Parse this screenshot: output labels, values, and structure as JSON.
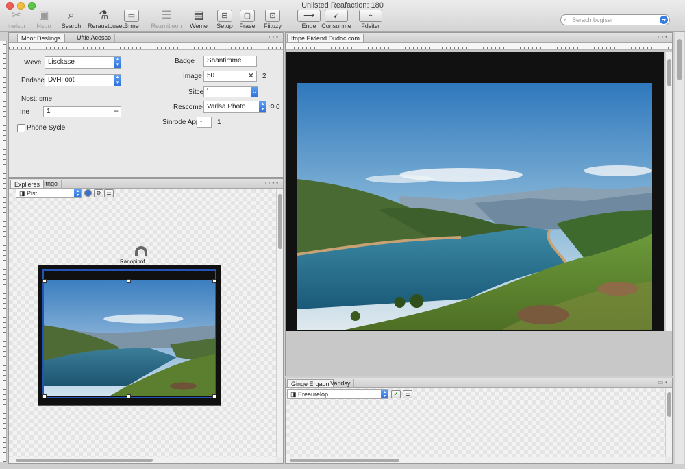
{
  "window": {
    "title": "Unlisted Reafaction: 180"
  },
  "toolbar": {
    "left_items": [
      {
        "label": "Inelsor",
        "glyph": "✂"
      },
      {
        "label": "Nsdo",
        "glyph": "▣"
      },
      {
        "label": "Search",
        "glyph": "⌕"
      },
      {
        "label": "Reraustcused",
        "glyph": "⚗"
      },
      {
        "label": "Brme",
        "glyph": "▭"
      },
      {
        "label": "Rezmitieon",
        "glyph": "☰"
      },
      {
        "label": "Weme",
        "glyph": "▤"
      },
      {
        "label": "Setup",
        "glyph": "⊟"
      },
      {
        "label": "Frase",
        "glyph": "▢"
      },
      {
        "label": "Fiituzy",
        "glyph": "⊡"
      }
    ],
    "right_items": [
      {
        "label": "Enge",
        "glyph": "⟶"
      },
      {
        "label": "Consunme",
        "glyph": "➹"
      },
      {
        "label": "Fdsiter",
        "glyph": "⌁"
      }
    ],
    "search_placeholder": "Serach bvgiser"
  },
  "properties": {
    "tabs": [
      "Moor Deslings",
      "Uftle Acesso"
    ],
    "weve_label": "Weve",
    "weve_value": "Lisckase",
    "produce_label": "Pndace",
    "produce_value": "DvHl oot",
    "nost_label": "Nost: sme",
    "ine_label": "Ine",
    "ine_value": "1",
    "phone_label": "Phone Sycle",
    "badge_label": "Badge",
    "badge_value": "Shantimme",
    "image_label": "Image",
    "image_value": "50",
    "image_count": "2",
    "sitce_label": "Sitce",
    "sitce_value": "'",
    "rescomee_label": "Rescomee",
    "rescomee_value": "Varlsa Photo",
    "rescomee_suffix": "0",
    "sinrode_label": "Sinrode App",
    "sinrode_value": "-",
    "sinrode_count": "1"
  },
  "explorer": {
    "tabs": [
      "Explieres",
      "Itngo"
    ],
    "dropdown_value": "Pist",
    "thumb_caption": "Ranopinof"
  },
  "viewer": {
    "tab": "Itnpe Pivlend Dudoc.com"
  },
  "bottom_panel": {
    "tabs": [
      "Ginge Ergaon",
      "Vandsy"
    ],
    "dropdown_value": "Ereaurelop"
  },
  "colors": {
    "accent_blue": "#2e6fd9",
    "canvas_black": "#111111"
  }
}
